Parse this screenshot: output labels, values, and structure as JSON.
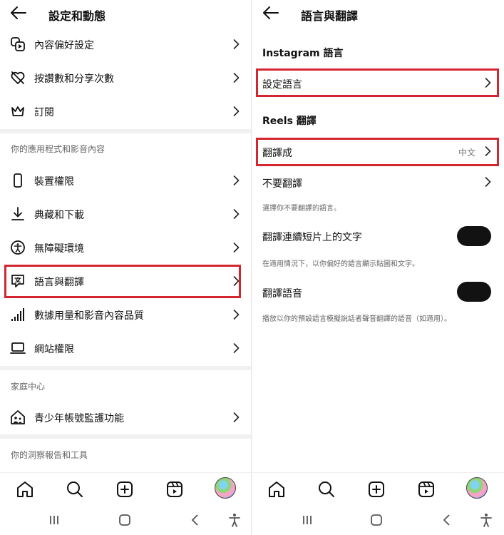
{
  "left": {
    "title": "設定和動態",
    "items_top": [
      {
        "label": "內容偏好設定",
        "icon": "content-preferences-icon"
      },
      {
        "label": "按讚數和分享次數",
        "icon": "heart-crossed-icon"
      },
      {
        "label": "訂閱",
        "icon": "crown-icon"
      }
    ],
    "section_apps": "你的應用程式和影音內容",
    "items_apps": [
      {
        "label": "裝置權限",
        "icon": "phone-icon"
      },
      {
        "label": "典藏和下載",
        "icon": "download-icon"
      },
      {
        "label": "無障礙環境",
        "icon": "accessibility-icon"
      },
      {
        "label": "語言與翻譯",
        "icon": "translate-icon"
      },
      {
        "label": "數據用量和影音內容品質",
        "icon": "signal-bars-icon"
      },
      {
        "label": "網站權限",
        "icon": "laptop-icon"
      }
    ],
    "section_family": "家庭中心",
    "items_family": [
      {
        "label": "青少年帳號監護功能",
        "icon": "family-home-icon"
      }
    ],
    "section_insights": "你的洞察報告和工具"
  },
  "right": {
    "title": "語言與翻譯",
    "section_instagram": "Instagram 語言",
    "set_language": "設定語言",
    "section_reels": "Reels 翻譯",
    "translate_to": "翻譯成",
    "translate_to_value": "中文",
    "dont_translate": "不要翻譯",
    "dont_translate_note": "選擇你不要翻譯的語言。",
    "translate_text": "翻譯連續短片上的文字",
    "translate_text_note": "在適用情況下，以你偏好的語言顯示貼圖和文字。",
    "translate_audio": "翻譯語音",
    "translate_audio_note": "播放以你的預設語言模擬說話者聲音翻譯的語音（如適用）。"
  },
  "highlight_color": "#d3262e",
  "nav_icons": [
    "home-icon",
    "search-icon",
    "create-icon",
    "reels-icon",
    "profile-avatar"
  ],
  "system_icons": [
    "recent-apps-icon",
    "home-button-icon",
    "back-button-icon",
    "accessibility-shortcut-icon"
  ]
}
